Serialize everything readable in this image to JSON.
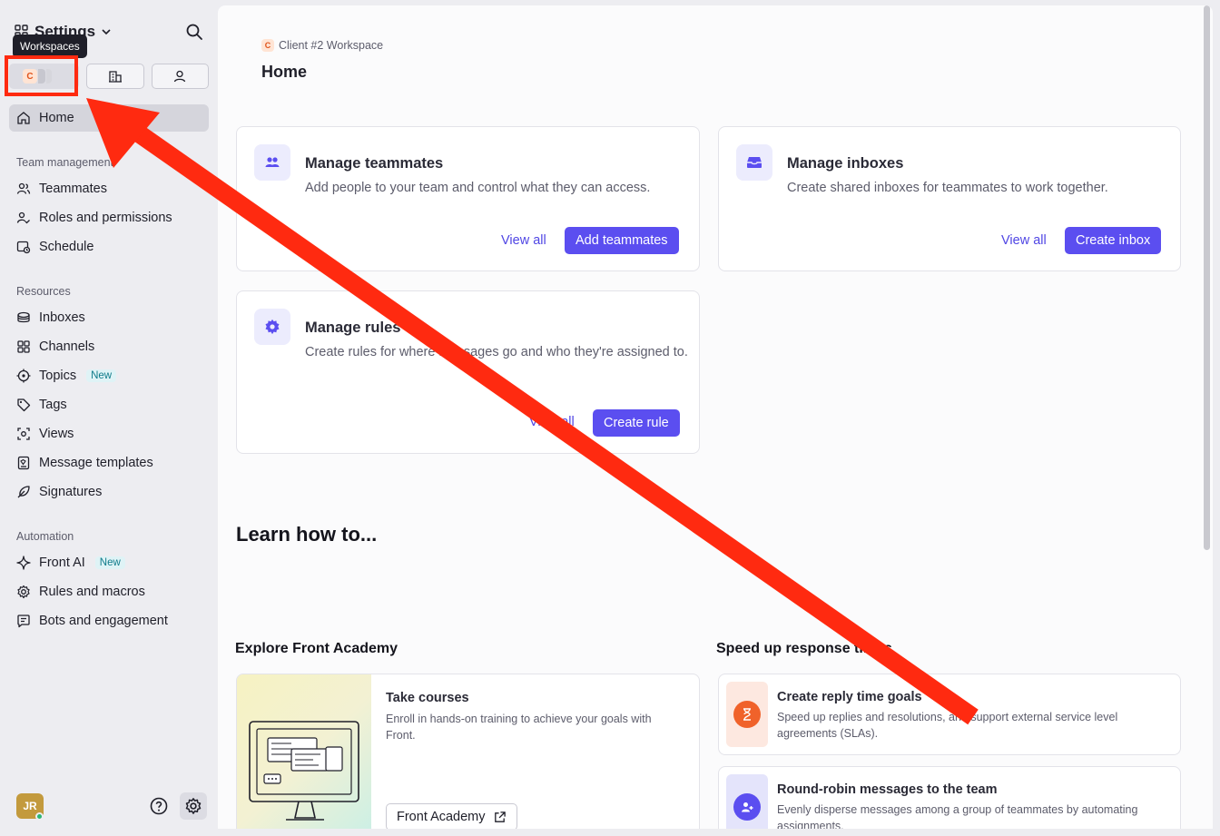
{
  "sidebar": {
    "title": "Settings",
    "tooltip": "Workspaces",
    "workspace_letter": "C",
    "home": "Home",
    "sections": {
      "team": "Team management",
      "resources": "Resources",
      "automation": "Automation"
    },
    "team_items": [
      "Teammates",
      "Roles and permissions",
      "Schedule"
    ],
    "resource_items": [
      "Inboxes",
      "Channels",
      "Topics",
      "Tags",
      "Views",
      "Message templates",
      "Signatures"
    ],
    "automation_items": [
      "Front AI",
      "Rules and macros",
      "Bots and engagement"
    ],
    "new_badge": "New",
    "avatar_initials": "JR"
  },
  "main": {
    "breadcrumb": "Client #2 Workspace",
    "breadcrumb_letter": "C",
    "title": "Home",
    "cards": [
      {
        "title": "Manage teammates",
        "desc": "Add people to your team and control what they can access.",
        "link": "View all",
        "button": "Add teammates"
      },
      {
        "title": "Manage inboxes",
        "desc": "Create shared inboxes for teammates to work together.",
        "link": "View all",
        "button": "Create inbox"
      },
      {
        "title": "Manage rules",
        "desc": "Create rules for where messages go and who they're assigned to.",
        "link": "View all",
        "button": "Create rule"
      }
    ],
    "learn_title": "Learn how to...",
    "academy": {
      "heading": "Explore Front Academy",
      "title": "Take courses",
      "desc": "Enroll in hands-on training to achieve your goals with Front.",
      "button": "Front Academy"
    },
    "speed": {
      "heading": "Speed up response times",
      "items": [
        {
          "title": "Create reply time goals",
          "desc": "Speed up replies and resolutions, and support external service level agreements (SLAs)."
        },
        {
          "title": "Round-robin messages to the team",
          "desc": "Evenly disperse messages among a group of teammates by automating assignments."
        }
      ]
    }
  },
  "colors": {
    "accent": "#5b4ef0",
    "annotation": "#ff2a10"
  }
}
